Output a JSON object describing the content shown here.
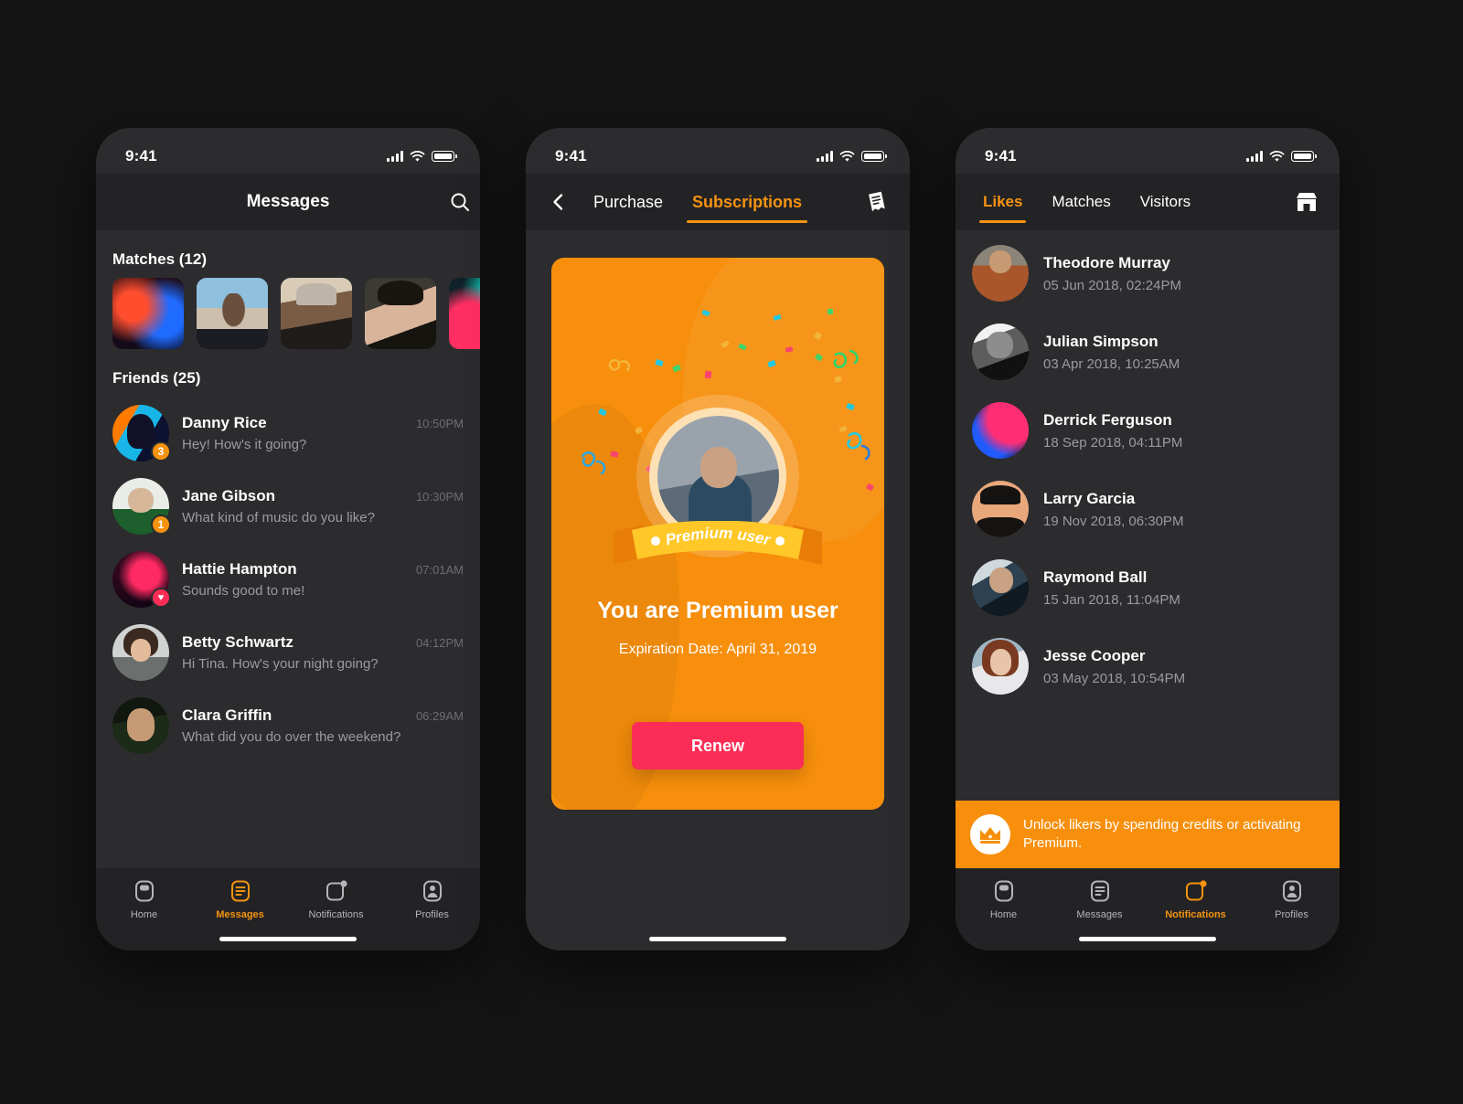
{
  "status_bar": {
    "time": "9:41"
  },
  "phone1": {
    "title": "Messages",
    "search_icon": "search-icon",
    "matches_title": "Matches (12)",
    "matches": [
      {
        "id": "m1",
        "art": "p-neon1"
      },
      {
        "id": "m2",
        "art": "p-street"
      },
      {
        "id": "m3",
        "art": "p-cap"
      },
      {
        "id": "m4",
        "art": "p-dark"
      },
      {
        "id": "m5",
        "art": "p-pinkteal"
      }
    ],
    "friends_title": "Friends (25)",
    "friends": [
      {
        "name": "Danny Rice",
        "time": "10:50PM",
        "message": "Hey! How's it going?",
        "badge": "3",
        "badge_type": "count",
        "art": "p-neon2"
      },
      {
        "name": "Jane Gibson",
        "time": "10:30PM",
        "message": "What kind of music do you like?",
        "badge": "1",
        "badge_type": "count",
        "art": "p-white1"
      },
      {
        "name": "Hattie Hampton",
        "time": "07:01AM",
        "message": "Sounds good to me!",
        "badge": "♥",
        "badge_type": "heart",
        "art": "p-redsil"
      },
      {
        "name": "Betty Schwartz",
        "time": "04:12PM",
        "message": "Hi Tina. How's your night going?",
        "badge": "",
        "badge_type": "none",
        "art": "p-curly"
      },
      {
        "name": "Clara Griffin",
        "time": "06:29AM",
        "message": "What did you do over the weekend?",
        "badge": "",
        "badge_type": "none",
        "art": "p-glasses"
      }
    ],
    "tabs": [
      {
        "label": "Home",
        "icon": "home-icon",
        "active": false
      },
      {
        "label": "Messages",
        "icon": "messages-icon",
        "active": true
      },
      {
        "label": "Notifications",
        "icon": "notifications-icon",
        "active": false
      },
      {
        "label": "Profiles",
        "icon": "profiles-icon",
        "active": false
      }
    ]
  },
  "phone2": {
    "back_icon": "chevron-left-icon",
    "receipt_icon": "receipt-icon",
    "segments": [
      {
        "label": "Purchase",
        "active": false
      },
      {
        "label": "Subscriptions",
        "active": true
      }
    ],
    "card": {
      "ribbon_label": "Premium user",
      "title": "You are Premium user",
      "subtitle": "Expiration Date: April 31, 2019",
      "button_label": "Renew",
      "card_color": "#f78f0c",
      "button_color": "#fb2d56"
    }
  },
  "phone3": {
    "store_icon": "store-icon",
    "tabs": [
      {
        "label": "Likes",
        "active": true
      },
      {
        "label": "Matches",
        "active": false
      },
      {
        "label": "Visitors",
        "active": false
      }
    ],
    "likes": [
      {
        "name": "Theodore Murray",
        "date": "05 Jun 2018, 02:24PM",
        "art": "p-brownjk"
      },
      {
        "name": "Julian Simpson",
        "date": "03 Apr 2018, 10:25AM",
        "art": "p-bw"
      },
      {
        "name": "Derrick Ferguson",
        "date": "18 Sep 2018, 04:11PM",
        "art": "p-bluemask"
      },
      {
        "name": "Larry Garcia",
        "date": "19 Nov 2018, 06:30PM",
        "art": "p-hat"
      },
      {
        "name": "Raymond Ball",
        "date": "15 Jan 2018, 11:04PM",
        "art": "p-night"
      },
      {
        "name": "Jesse Cooper",
        "date": "03 May 2018, 10:54PM",
        "art": "p-girl"
      }
    ],
    "promo": {
      "icon": "crown-icon",
      "text": "Unlock likers by spending credits or activating Premium.",
      "color": "#f78f0c"
    },
    "tabs_bottom": [
      {
        "label": "Home",
        "icon": "home-icon",
        "active": false
      },
      {
        "label": "Messages",
        "icon": "messages-icon",
        "active": false
      },
      {
        "label": "Notifications",
        "icon": "notifications-icon",
        "active": true
      },
      {
        "label": "Profiles",
        "icon": "profiles-icon",
        "active": false
      }
    ]
  },
  "theme": {
    "accent": "#f59310",
    "page_bg": "#141415",
    "screen_bg": "#2c2c2e",
    "bar_bg": "#232325",
    "pink": "#fb2d56"
  }
}
